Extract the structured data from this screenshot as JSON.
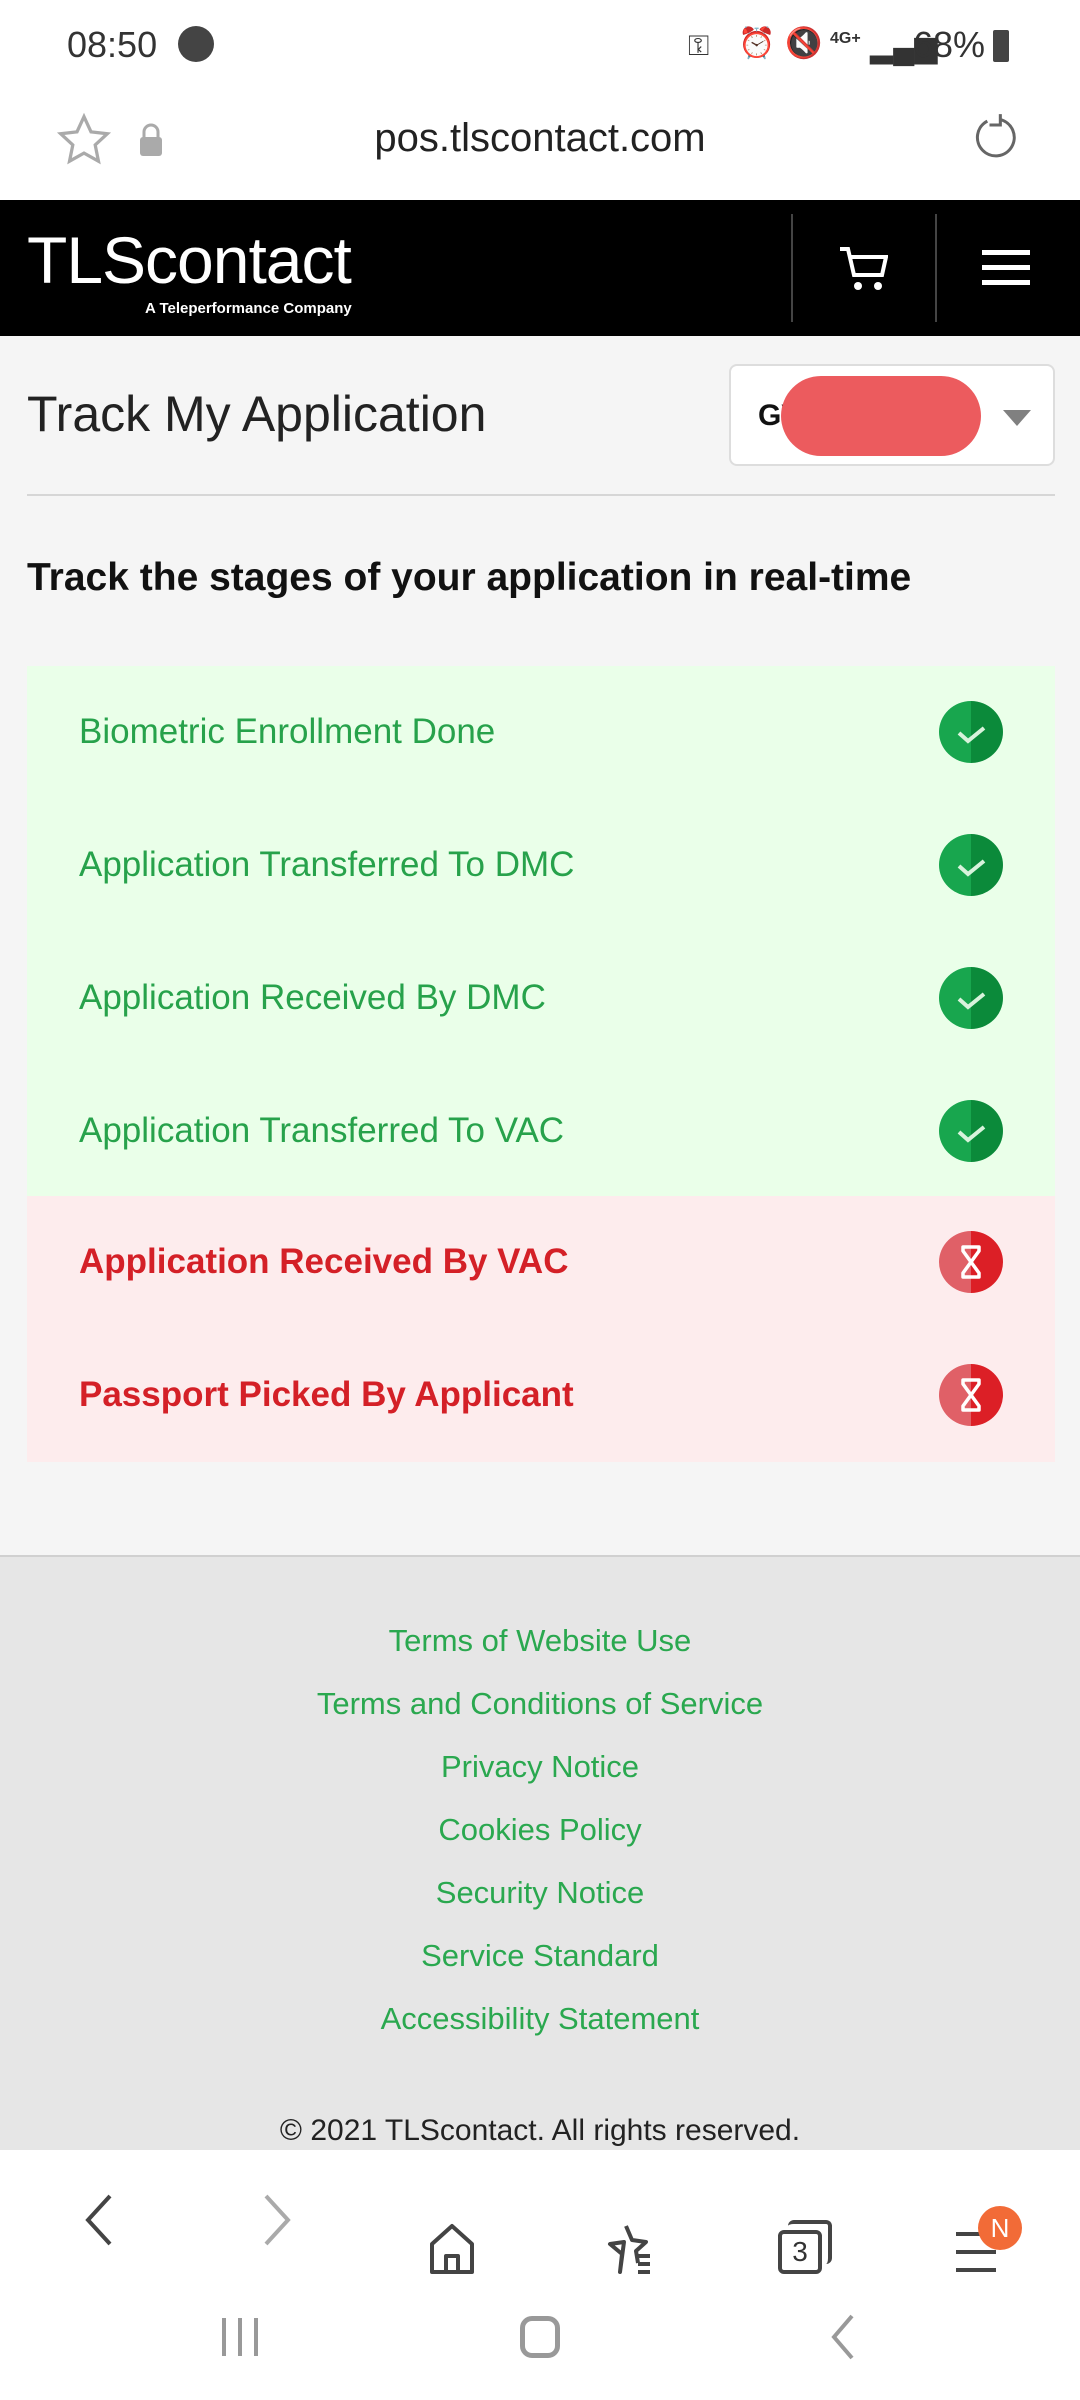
{
  "status": {
    "time": "08:50",
    "battery": "68%",
    "network": "4G+"
  },
  "browser": {
    "url": "pos.tlscontact.com",
    "tabs_count": "3",
    "menu_badge": "N"
  },
  "header": {
    "logo_main": "TLScontact",
    "logo_sub": "A Teleperformance Company"
  },
  "page": {
    "title": "Track My Application",
    "selector_value": "GV…2",
    "subtitle": "Track the stages of your application in real-time"
  },
  "stages": [
    {
      "label": "Biometric Enrollment Done",
      "status": "done"
    },
    {
      "label": "Application Transferred To DMC",
      "status": "done"
    },
    {
      "label": "Application Received By DMC",
      "status": "done"
    },
    {
      "label": "Application Transferred To VAC",
      "status": "done"
    },
    {
      "label": "Application Received By VAC",
      "status": "pending"
    },
    {
      "label": "Passport Picked By Applicant",
      "status": "pending"
    }
  ],
  "colors": {
    "done": "#27a24b",
    "pending": "#d42027",
    "done_bg": "#eaffe9",
    "pending_bg": "#fdeced"
  },
  "footer": {
    "links": [
      "Terms of Website Use",
      "Terms and Conditions of Service",
      "Privacy Notice",
      "Cookies Policy",
      "Security Notice",
      "Service Standard",
      "Accessibility Statement"
    ],
    "copyright": "© 2021 TLScontact. All rights reserved."
  }
}
